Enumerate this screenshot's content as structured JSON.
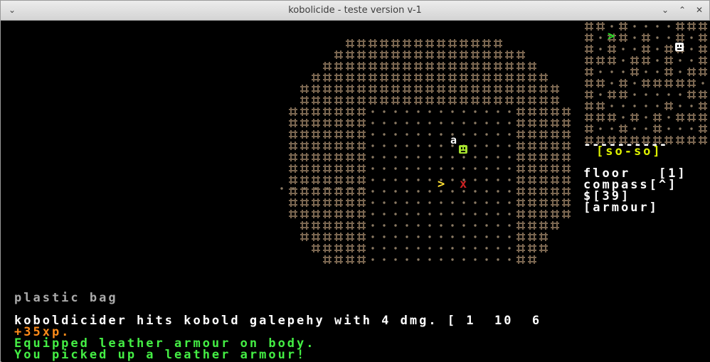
{
  "window": {
    "title": "kobolicide - teste version v-1"
  },
  "colors": {
    "wall": "#7a6650",
    "floor": "#8b7a63",
    "player": "#ffe033",
    "kobold": "#a6e22e",
    "trap": "#cc2222",
    "minimap_exit": "#22dd22",
    "status_yellow": "#ddf000",
    "xp_orange": "#ff8c1a",
    "msg_green": "#44ee44"
  },
  "map": {
    "monster_letter": "a",
    "player_icon": "player-arrow-icon",
    "monster_icon": "kobold-face-icon",
    "trap_icon": "trap-x-icon"
  },
  "sidebar": {
    "divider": "----------",
    "condition": "[so-so]",
    "floor_line": "floor   [1]",
    "compass_line": "compass[^]",
    "money_line": "$[39]",
    "equipment_line": "[armour]"
  },
  "ground_item": "plastic bag",
  "messages": [
    {
      "text": "koboldicider hits kobold galepehy with 4 dmg. [ 1  10  6"
    },
    {
      "text": "+35xp."
    },
    {
      "text": "Equipped leather armour on body."
    },
    {
      "text": "You picked up a leather armour!"
    }
  ]
}
